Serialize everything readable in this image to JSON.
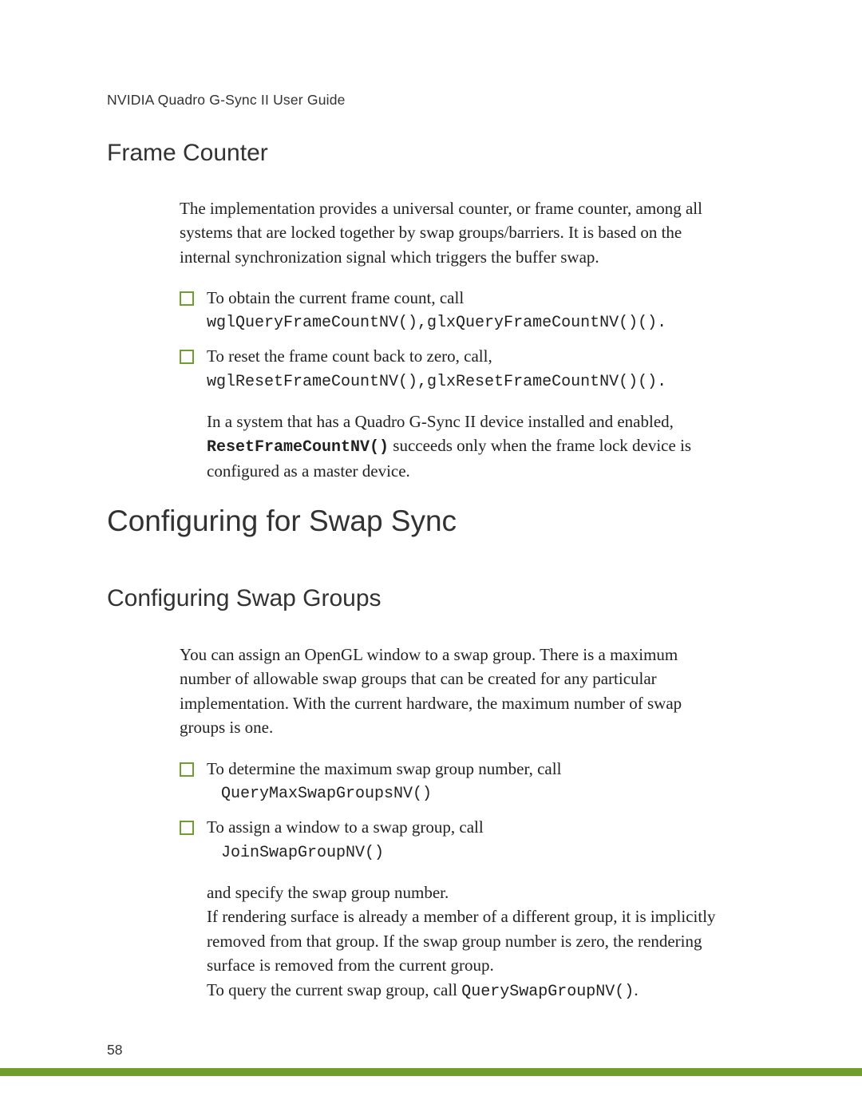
{
  "header": {
    "title": "NVIDIA Quadro G-Sync II User Guide"
  },
  "section1": {
    "heading": "Frame Counter",
    "intro": "The implementation provides a universal counter, or frame counter, among all systems that are locked together by swap groups/barriers. It is based on the internal synchronization signal which triggers the buffer swap.",
    "bullets": [
      {
        "text": "To obtain the current frame count, call",
        "code": "wglQueryFrameCountNV(),glxQueryFrameCountNV()()."
      },
      {
        "text": "To reset the frame count back to zero, call,",
        "code": "wglResetFrameCountNV(),glxResetFrameCountNV()()."
      }
    ],
    "note_pre": "In a system that has a Quadro G-Sync II device installed and enabled, ",
    "note_code": "ResetFrameCountNV()",
    "note_post": " succeeds only when the frame lock device is configured as a master device."
  },
  "section2": {
    "heading": "Configuring for Swap Sync",
    "sub": {
      "heading": "Configuring Swap Groups",
      "intro": "You can assign an OpenGL window to a swap group. There is a maximum number of allowable swap groups that can be created for any particular implementation. With the current hardware, the maximum number of swap groups is one.",
      "bullets": [
        {
          "text": "To determine the maximum swap group number, call",
          "code": "QueryMaxSwapGroupsNV()"
        },
        {
          "text": "To assign a window to a swap group, call",
          "code": "JoinSwapGroupNV()"
        }
      ],
      "tail_line1": "and specify the swap group number.",
      "tail_line2": "If rendering surface is already a member of a different group, it is implicitly removed from that group. If the swap group number is zero, the rendering surface is removed from the current group.",
      "tail_line3_pre": "To query the current swap group, call ",
      "tail_line3_code": "QuerySwapGroupNV()",
      "tail_line3_post": "."
    }
  },
  "footer": {
    "page": "58"
  }
}
